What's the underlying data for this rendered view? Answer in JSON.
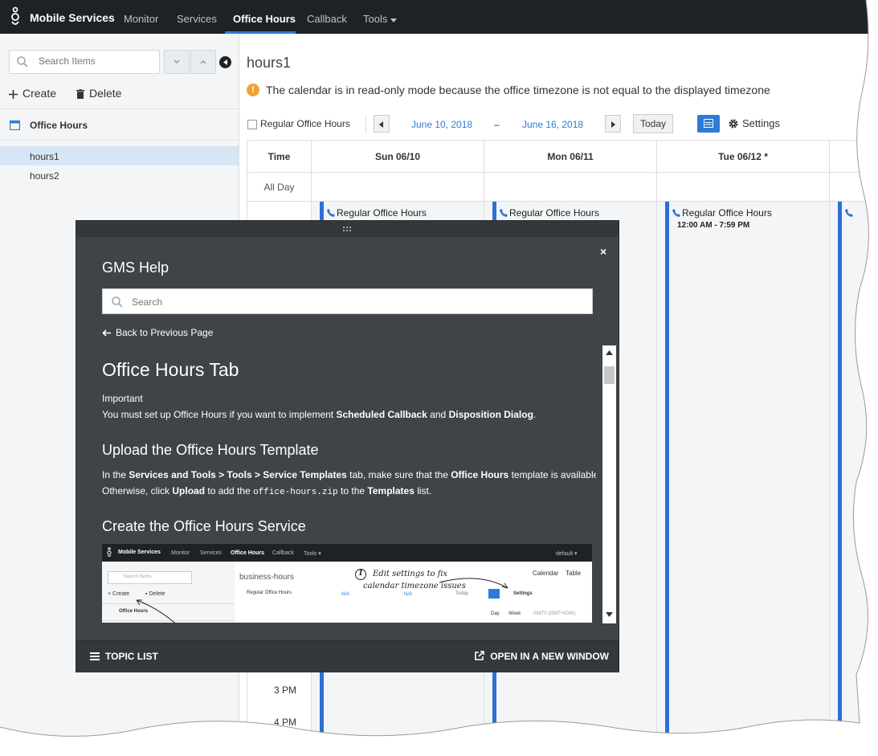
{
  "nav": {
    "brand": "Mobile Services",
    "items": [
      "Monitor",
      "Services",
      "Office Hours",
      "Callback",
      "Tools"
    ],
    "active_index": 2
  },
  "sidebar": {
    "search_placeholder": "Search Items",
    "create_label": "Create",
    "delete_label": "Delete",
    "section_label": "Office Hours",
    "items": [
      "hours1",
      "hours2"
    ],
    "selected_index": 0
  },
  "main": {
    "title": "hours1",
    "info_message": "The calendar is in read-only mode because the office timezone is not equal to the displayed timezone",
    "toolbar": {
      "checkbox_label": "Regular Office Hours",
      "start_date": "June 10, 2018",
      "separator": "–",
      "end_date": "June 16, 2018",
      "today_label": "Today",
      "settings_label": "Settings"
    },
    "calendar": {
      "time_header": "Time",
      "allday_label": "All Day",
      "days": [
        "Sun 06/10",
        "Mon 06/11",
        "Tue 06/12 *"
      ],
      "event_title": "Regular Office Hours",
      "event_time": "12:00 AM - 7:59 PM",
      "time_labels": [
        "3 PM",
        "4 PM"
      ]
    }
  },
  "help": {
    "title": "GMS Help",
    "search_placeholder": "Search",
    "back_label": "Back to Previous Page",
    "article_title": "Office Hours Tab",
    "important_label": "Important",
    "important_pre": "You must set up Office Hours if you want to implement ",
    "important_b1": "Scheduled Callback",
    "important_mid": " and ",
    "important_b2": "Disposition Dialog",
    "important_end": ".",
    "section1_title": "Upload the Office Hours Template",
    "s1_l1_pre": "In the ",
    "s1_l1_b1": "Services and Tools > Tools > Service Templates",
    "s1_l1_mid": " tab, make sure that the ",
    "s1_l1_b2": "Office Hours",
    "s1_l1_end": " template is available.",
    "s1_l2_pre": "Otherwise, click ",
    "s1_l2_b1": "Upload",
    "s1_l2_mid": " to add the ",
    "s1_l2_code": "office-hours.zip",
    "s1_l2_mid2": " to the ",
    "s1_l2_b2": "Templates",
    "s1_l2_end": " list.",
    "section2_title": "Create the Office Hours Service",
    "footer_topic_list": "TOPIC LIST",
    "footer_open_new": "OPEN IN A NEW WINDOW",
    "mini": {
      "brand": "Mobile Services",
      "nav": [
        "Monitor",
        "Services",
        "Office Hours",
        "Callback",
        "Tools ▾"
      ],
      "default_label": "default ▾",
      "search_placeholder": "Search Items",
      "create": "Create",
      "delete": "Delete",
      "section": "Office Hours",
      "title": "business-hours",
      "checkbox": "Regular Office Hours",
      "na1": "N/A",
      "na2": "N/A",
      "today": "Today",
      "settings": "Settings",
      "calendar_tab": "Calendar",
      "table_tab": "Table",
      "day": "Day",
      "week": "Week",
      "tz": "GMT0 (GMT+0000)",
      "annotation_number": "1",
      "annotation_line1": "Edit settings to fix",
      "annotation_line2": "calendar timezone issues"
    }
  }
}
